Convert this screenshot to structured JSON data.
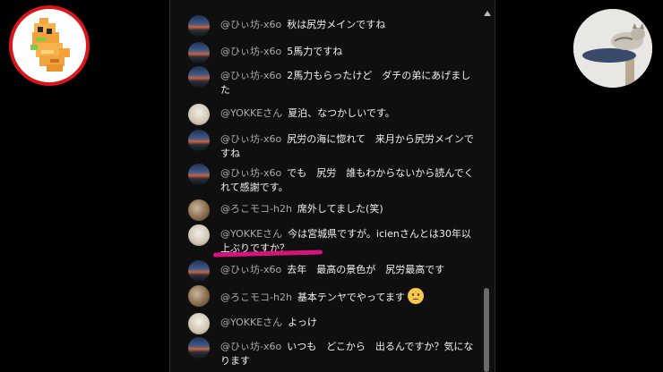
{
  "colors": {
    "background": "#000000",
    "panel": "#0f0f0f",
    "author_text": "#aaaaaa",
    "message_text": "#f1f1f1",
    "highlight": "#d4147c",
    "badge_ring": "#d9161c"
  },
  "icons": {
    "left_badge": "pixel-art-mascot-icon",
    "right_badge": "cat-photo-icon",
    "scroll_up": "caret-up-icon",
    "emoji": "neutral-face-emoji-icon"
  },
  "chat": {
    "messages": [
      {
        "author": "@ひぃ坊-x6o",
        "text": "秋は尻労メインですね"
      },
      {
        "author": "@ひぃ坊-x6o",
        "text": "5馬力ですね"
      },
      {
        "author": "@ひぃ坊-x6o",
        "text": "2馬力もらったけど　ダチの弟にあげました"
      },
      {
        "author": "@YOKKEさん",
        "text": "夏泊、なつかしいです。"
      },
      {
        "author": "@ひぃ坊-x6o",
        "text": "尻労の海に惚れて　来月から尻労メインですね"
      },
      {
        "author": "@ひぃ坊-x6o",
        "text": "でも　尻労　誰もわからないから読んでくれて感謝です。"
      },
      {
        "author": "@ろこモコ-h2h",
        "text": "席外してました(笑)"
      },
      {
        "author": "@YOKKEさん",
        "text": "今は宮城県ですが。icienさんとは30年以上ぶりですか？"
      },
      {
        "author": "@ひぃ坊-x6o",
        "text": "去年　最高の景色が　尻労最高です"
      },
      {
        "author": "@ろこモコ-h2h",
        "text": "基本テンヤでやってます"
      },
      {
        "author": "@YOKKEさん",
        "text": "よっけ"
      },
      {
        "author": "@ひぃ坊-x6o",
        "text": "いつも　どこから　出るんですか？気になります"
      }
    ]
  }
}
